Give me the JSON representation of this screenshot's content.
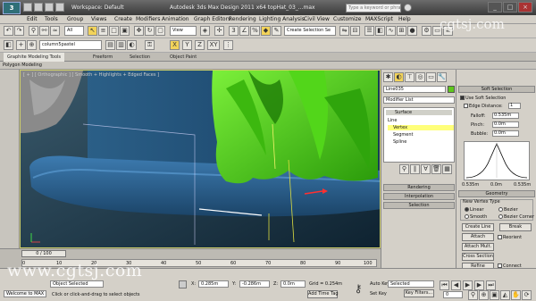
{
  "window": {
    "workspace": "Workspace: Default",
    "title": "Autodesk 3ds Max Design 2011 x64   topHat_03_...max",
    "search_placeholder": "Type a keyword or phrase",
    "help_icon": "help-icon"
  },
  "menu": [
    "Edit",
    "Tools",
    "Group",
    "Views",
    "Create",
    "Modifiers",
    "Animation",
    "Graph Editors",
    "Rendering",
    "Lighting Analysis",
    "Civil View",
    "Customize",
    "MAXScript",
    "Help"
  ],
  "toolbar": {
    "filter": "All",
    "view": "View",
    "selection_set": "Create Selection Se",
    "layer": "column5pastel",
    "axis_x": "X",
    "axis_y": "Y",
    "axis_z": "Z",
    "axis_xy": "XY"
  },
  "ribbon": {
    "tabs": [
      "Graphite Modeling Tools",
      "Freeform",
      "Selection",
      "Object Paint"
    ],
    "sub": "Polygon Modeling"
  },
  "viewport": {
    "label": "[ + ] [ Orthographic ] [ Smooth + Highlights + Edged Faces ]"
  },
  "command_panel": {
    "object_name": "Line035",
    "modifier_list": "Modifier List",
    "stack": {
      "surface": "Surface",
      "line": "Line",
      "vertex": "Vertex",
      "segment": "Segment",
      "spline": "Spline"
    },
    "rollouts": [
      "Rendering",
      "Interpolation",
      "Selection"
    ]
  },
  "soft_selection": {
    "header": "Soft Selection",
    "use_soft": "Use Soft Selection",
    "edge_distance": "Edge Distance:",
    "edge_distance_value": "1",
    "falloff_label": "Falloff:",
    "falloff_value": "0.535m",
    "pinch_label": "Pinch:",
    "pinch_value": "0.0m",
    "bubble_label": "Bubble:",
    "bubble_value": "0.0m",
    "graph_min": "0.535m",
    "graph_mid": "0.0m",
    "graph_max": "0.535m",
    "geometry_header": "Geometry",
    "new_vertex_type": "New Vertex Type",
    "linear": "Linear",
    "bezier": "Bezier",
    "smooth": "Smooth",
    "bezier_corner": "Bezier Corner",
    "create_line": "Create Line",
    "break": "Break",
    "attach": "Attach",
    "reorient": "Reorient",
    "attach_mult": "Attach Mult.",
    "cross_section": "Cross Section",
    "refine": "Refine",
    "connect": "Connect"
  },
  "timeline": {
    "slider": "0 / 100",
    "ticks": [
      "0",
      "10",
      "20",
      "30",
      "40",
      "50",
      "60",
      "70",
      "80",
      "90",
      "100"
    ]
  },
  "status": {
    "script": "Welcome to MAX",
    "selected": "Object Selected",
    "prompt": "Click or click-and-drag to select objects",
    "x_label": "X:",
    "x_value": "0.285m",
    "y_label": "Y:",
    "y_value": "-0.286m",
    "z_label": "Z:",
    "z_value": "0.0m",
    "grid": "Grid = 0.254m",
    "auto_key": "Auto Key",
    "selected_drop": "Selected",
    "set_key": "Set Key",
    "key_filters": "Key Filters...",
    "add_time_tag": "Add Time Tag",
    "frame": "0"
  },
  "watermarks": {
    "bottom_left": "www.cgtsj.com",
    "top_right": "cgtsj.com"
  },
  "colors": {
    "hat_blue": "#2a5f8f",
    "plant_green": "#4dd414",
    "viewport_bg": "#1e4258"
  }
}
